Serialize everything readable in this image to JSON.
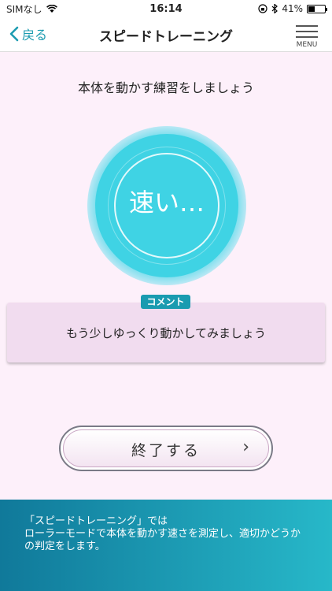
{
  "status_bar": {
    "carrier": "SIMなし",
    "time": "16:14",
    "battery": "41%",
    "battery_level": 0.41
  },
  "nav": {
    "back_label": "戻る",
    "title": "スピードトレーニング",
    "menu_label": "MENU"
  },
  "instruction": "本体を動かす練習をしましょう",
  "speed_indicator": "速い…",
  "comment": {
    "badge": "コメント",
    "text": "もう少しゆっくり動かしてみましょう"
  },
  "finish_button": {
    "label": "終了する",
    "arrow": "›"
  },
  "footer": {
    "line1": "「スピードトレーニング」では",
    "line2": "ローラーモードで本体を動かす速さを測定し、適切かどうか",
    "line3": "の判定をします。"
  },
  "colors": {
    "accent": "#1a9bb0",
    "circle": "#3fd3e4",
    "background": "#fdf0fa",
    "comment_bg": "#f1dcef"
  }
}
